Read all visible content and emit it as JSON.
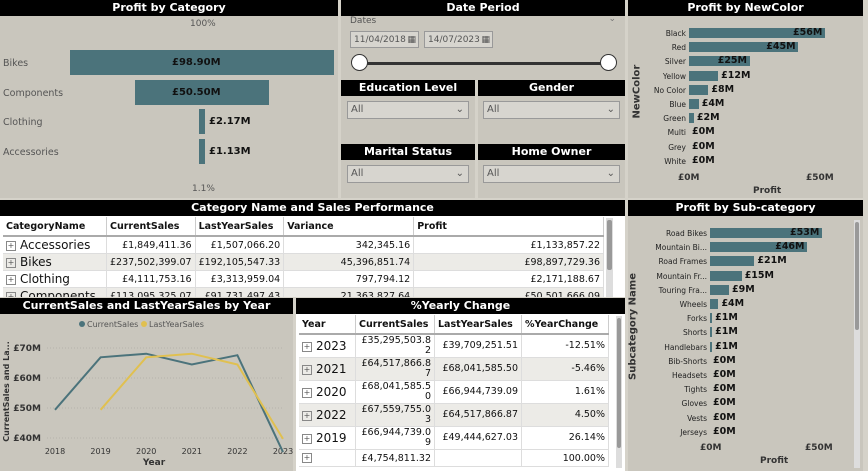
{
  "profit_by_category": {
    "title": "Profit by Category",
    "top_pct": "100%",
    "bottom_pct": "1.1%",
    "items": [
      {
        "label": "Bikes",
        "value": "£98.90M",
        "fraction": 1.0
      },
      {
        "label": "Components",
        "value": "£50.50M",
        "fraction": 0.51
      },
      {
        "label": "Clothing",
        "value": "£2.17M",
        "fraction": 0.022
      },
      {
        "label": "Accessories",
        "value": "£1.13M",
        "fraction": 0.011
      }
    ]
  },
  "date_period": {
    "title": "Date Period",
    "field_label": "Dates",
    "start": "11/04/2018",
    "end": "14/07/2023"
  },
  "slicers": [
    {
      "title": "Education Level",
      "value": "All"
    },
    {
      "title": "Gender",
      "value": "All"
    },
    {
      "title": "Marital Status",
      "value": "All"
    },
    {
      "title": "Home Owner",
      "value": "All"
    }
  ],
  "profit_by_newcolor": {
    "title": "Profit by NewColor",
    "axis_label": "NewColor",
    "x_title": "Profit",
    "x_ticks": [
      "£0M",
      "£50M"
    ],
    "items": [
      {
        "label": "Black",
        "value": "£56M",
        "amount": 56
      },
      {
        "label": "Red",
        "value": "£45M",
        "amount": 45
      },
      {
        "label": "Silver",
        "value": "£25M",
        "amount": 25
      },
      {
        "label": "Yellow",
        "value": "£12M",
        "amount": 12
      },
      {
        "label": "No Color",
        "value": "£8M",
        "amount": 8
      },
      {
        "label": "Blue",
        "value": "£4M",
        "amount": 4
      },
      {
        "label": "Green",
        "value": "£2M",
        "amount": 2
      },
      {
        "label": "Multi",
        "value": "£0M",
        "amount": 0
      },
      {
        "label": "Grey",
        "value": "£0M",
        "amount": 0
      },
      {
        "label": "White",
        "value": "£0M",
        "amount": 0
      }
    ]
  },
  "category_table": {
    "title": "Category Name and Sales Performance",
    "columns": [
      "CategoryName",
      "CurrentSales",
      "LastYearSales",
      "Variance",
      "Profit"
    ],
    "rows": [
      [
        "Accessories",
        "£1,849,411.36",
        "£1,507,066.20",
        "342,345.16",
        "£1,133,857.22"
      ],
      [
        "Bikes",
        "£237,502,399.07",
        "£192,105,547.33",
        "45,396,851.74",
        "£98,897,729.36"
      ],
      [
        "Clothing",
        "£4,111,753.16",
        "£3,313,959.04",
        "797,794.12",
        "£2,171,188.67"
      ],
      [
        "Components",
        "£113,095,325.07",
        "£91,731,497.43",
        "21,363,827.64",
        "£50,501,666.09"
      ]
    ]
  },
  "profit_by_subcategory": {
    "title": "Profit by Sub-category",
    "axis_label": "Subcategory Name",
    "x_title": "Profit",
    "x_ticks": [
      "£0M",
      "£50M"
    ],
    "items": [
      {
        "label": "Road Bikes",
        "value": "£53M",
        "amount": 53
      },
      {
        "label": "Mountain Bi...",
        "value": "£46M",
        "amount": 46
      },
      {
        "label": "Road Frames",
        "value": "£21M",
        "amount": 21
      },
      {
        "label": "Mountain Fr...",
        "value": "£15M",
        "amount": 15
      },
      {
        "label": "Touring Fra...",
        "value": "£9M",
        "amount": 9
      },
      {
        "label": "Wheels",
        "value": "£4M",
        "amount": 4
      },
      {
        "label": "Forks",
        "value": "£1M",
        "amount": 1
      },
      {
        "label": "Shorts",
        "value": "£1M",
        "amount": 1
      },
      {
        "label": "Handlebars",
        "value": "£1M",
        "amount": 1
      },
      {
        "label": "Bib-Shorts",
        "value": "£0M",
        "amount": 0
      },
      {
        "label": "Headsets",
        "value": "£0M",
        "amount": 0
      },
      {
        "label": "Tights",
        "value": "£0M",
        "amount": 0
      },
      {
        "label": "Gloves",
        "value": "£0M",
        "amount": 0
      },
      {
        "label": "Vests",
        "value": "£0M",
        "amount": 0
      },
      {
        "label": "Jerseys",
        "value": "£0M",
        "amount": 0
      }
    ]
  },
  "chart_data": {
    "type": "line",
    "title": "CurrentSales and LastYearSales by Year",
    "xlabel": "Year",
    "ylabel": "CurrentSales and La...",
    "x": [
      2018,
      2019,
      2020,
      2021,
      2022,
      2023
    ],
    "y_ticks": [
      "£40M",
      "£50M",
      "£60M",
      "£70M"
    ],
    "ylim": [
      38,
      73
    ],
    "grid": true,
    "legend": "top",
    "series": [
      {
        "name": "CurrentSales",
        "color": "#4b737b",
        "values": [
          49.4,
          66.9,
          68.1,
          64.5,
          67.6,
          35.3
        ]
      },
      {
        "name": "LastYearSales",
        "color": "#e0c050",
        "values": [
          null,
          49.4,
          66.9,
          68.1,
          64.5,
          39.7
        ]
      }
    ]
  },
  "yearly_table": {
    "title": "%Yearly Change",
    "columns": [
      "Year",
      "CurrentSales",
      "LastYearSales",
      "%YearChange"
    ],
    "rows": [
      [
        "2023",
        "£35,295,503.82",
        "£39,709,251.51",
        "-12.51%"
      ],
      [
        "2021",
        "£64,517,866.87",
        "£68,041,585.50",
        "-5.46%"
      ],
      [
        "2020",
        "£68,041,585.50",
        "£66,944,739.09",
        "1.61%"
      ],
      [
        "2022",
        "£67,559,755.03",
        "£64,517,866.87",
        "4.50%"
      ],
      [
        "2019",
        "£66,944,739.09",
        "£49,444,627.03",
        "26.14%"
      ]
    ],
    "total": [
      "",
      "£4,754,811.32",
      "",
      "100.00%"
    ]
  }
}
